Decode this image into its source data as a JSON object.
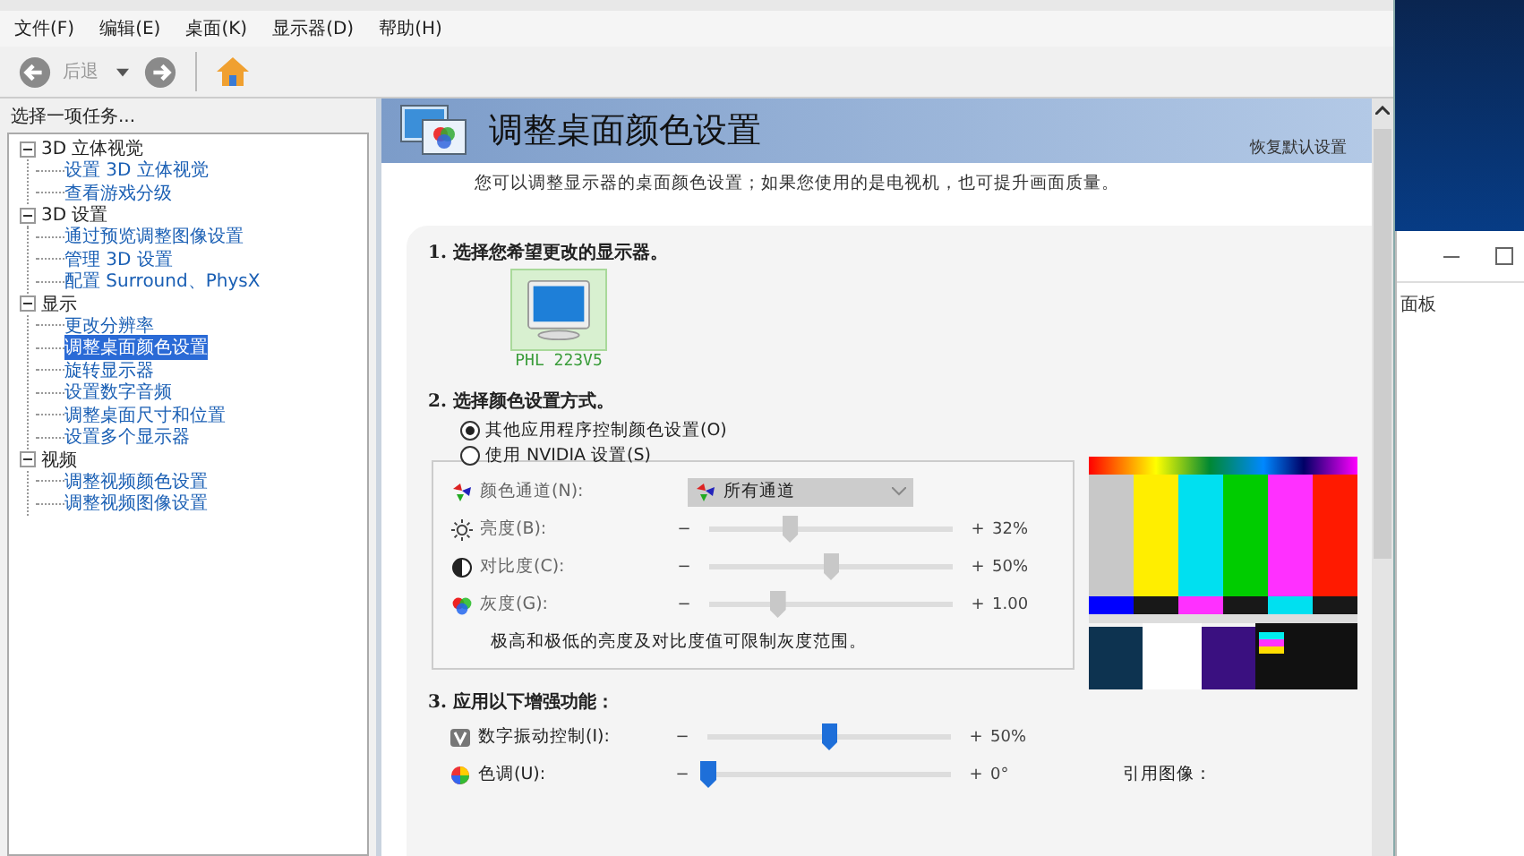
{
  "menu": [
    "文件(F)",
    "编辑(E)",
    "桌面(K)",
    "显示器(D)",
    "帮助(H)"
  ],
  "toolbar": {
    "back_label": "后退"
  },
  "task_panel": {
    "title": "选择一项任务...",
    "tree": [
      {
        "label": "3D 立体视觉",
        "expanded": true,
        "selected": false,
        "children": [
          {
            "label": "设置 3D 立体视觉",
            "selected": false
          },
          {
            "label": "查看游戏分级",
            "selected": false
          }
        ]
      },
      {
        "label": "3D 设置",
        "expanded": true,
        "selected": false,
        "children": [
          {
            "label": "通过预览调整图像设置",
            "selected": false
          },
          {
            "label": "管理 3D 设置",
            "selected": false
          },
          {
            "label": "配置 Surround、PhysX",
            "selected": false
          }
        ]
      },
      {
        "label": "显示",
        "expanded": true,
        "selected": false,
        "children": [
          {
            "label": "更改分辨率",
            "selected": false
          },
          {
            "label": "调整桌面颜色设置",
            "selected": true
          },
          {
            "label": "旋转显示器",
            "selected": false
          },
          {
            "label": "设置数字音频",
            "selected": false
          },
          {
            "label": "调整桌面尺寸和位置",
            "selected": false
          },
          {
            "label": "设置多个显示器",
            "selected": false
          }
        ]
      },
      {
        "label": "视频",
        "expanded": true,
        "selected": false,
        "children": [
          {
            "label": "调整视频颜色设置",
            "selected": false
          },
          {
            "label": "调整视频图像设置",
            "selected": false
          }
        ]
      }
    ]
  },
  "page": {
    "title": "调整桌面颜色设置",
    "restore_link": "恢复默认设置",
    "description": "您可以调整显示器的桌面颜色设置；如果您使用的是电视机，也可提升画面质量。",
    "section1": {
      "title": "1.  选择您希望更改的显示器。",
      "displays": [
        {
          "label": "PHL 223V5",
          "selected": true
        }
      ]
    },
    "section2": {
      "title": "2.  选择颜色设置方式。",
      "options": [
        {
          "label": "其他应用程序控制颜色设置(O)",
          "selected": true
        },
        {
          "label": "使用 NVIDIA 设置(S)",
          "selected": false
        }
      ],
      "channel": {
        "label": "颜色通道(N):",
        "value": "所有通道"
      },
      "sliders": [
        {
          "kind": "brightness",
          "label": "亮度(B):",
          "minus": "−",
          "plus": "+",
          "level": 0.33,
          "reading": "32%"
        },
        {
          "kind": "contrast",
          "label": "对比度(C):",
          "minus": "−",
          "plus": "+",
          "level": 0.5,
          "reading": "50%"
        },
        {
          "kind": "gamma",
          "label": "灰度(G):",
          "minus": "−",
          "plus": "+",
          "level": 0.28,
          "reading": "1.00"
        }
      ],
      "note": "极高和极低的亮度及对比度值可限制灰度范围。"
    },
    "section3": {
      "title": "3.  应用以下增强功能：",
      "sliders": [
        {
          "kind": "vibrance",
          "label": "数字振动控制(I):",
          "minus": "−",
          "plus": "+",
          "level": 0.5,
          "reading": "50%"
        },
        {
          "kind": "hue",
          "label": "色调(U):",
          "minus": "−",
          "plus": "+",
          "level": 0.0,
          "reading": "0°"
        }
      ]
    },
    "reference_label": "引用图像："
  },
  "background_window": {
    "text": "面板"
  }
}
